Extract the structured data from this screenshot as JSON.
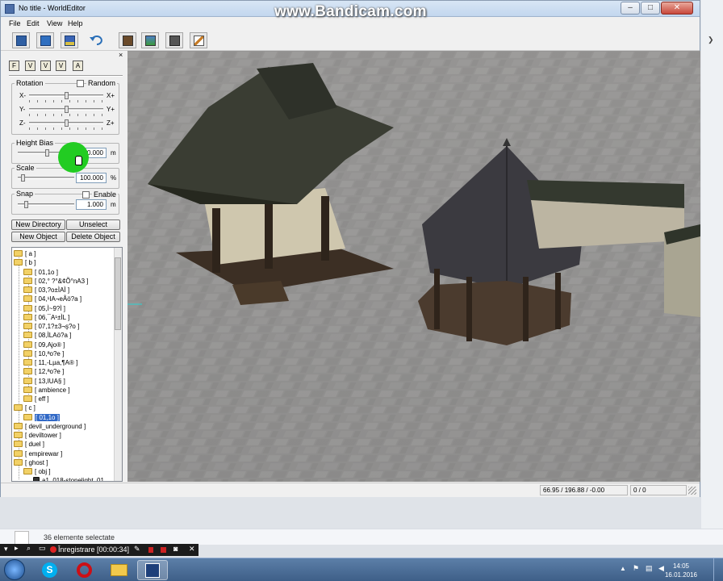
{
  "window": {
    "title": "No title - WorldEditor",
    "controls": {
      "minimize": "–",
      "maximize": "□",
      "close": "✕"
    }
  },
  "menu": [
    "File",
    "Edit",
    "View",
    "Help"
  ],
  "toolbar_icons": [
    "new-file-icon",
    "open-folder-icon",
    "save-icon",
    "undo-icon",
    "object-view-icon",
    "terrain-view-icon",
    "attribute-view-icon",
    "edit-pencil-icon"
  ],
  "panel": {
    "close": "×",
    "mode_buttons": [
      "F",
      "V",
      "V",
      "V",
      "A"
    ],
    "rotation": {
      "label": "Rotation",
      "random_label": "Random",
      "x_minus": "X-",
      "x_plus": "X+",
      "y_minus": "Y-",
      "y_plus": "Y+",
      "z_minus": "Z-",
      "z_plus": "Z+"
    },
    "height_bias": {
      "label": "Height Bias",
      "value": "0.000",
      "unit": "m"
    },
    "scale": {
      "label": "Scale",
      "value": "100.000",
      "unit": "%"
    },
    "snap": {
      "label": "Snap",
      "enable_label": "Enable",
      "value": "1.000",
      "unit": "m"
    },
    "buttons": {
      "new_directory": "New Directory",
      "unselect": "Unselect",
      "new_object": "New Object",
      "delete_object": "Delete Object"
    }
  },
  "tree": [
    {
      "label": "[ a ]",
      "level": 0
    },
    {
      "label": "[ b ]",
      "level": 0
    },
    {
      "label": "[ 01,1o ]",
      "level": 1
    },
    {
      "label": "[ 02,° ?°&¢Õ°nA3 ]",
      "level": 1
    },
    {
      "label": "[ 03,?o±ÌAÌ ]",
      "level": 1
    },
    {
      "label": "[ 04,¹IA¬eÅö?a ]",
      "level": 1
    },
    {
      "label": "[ 05,Ì~9?Ì ]",
      "level": 1
    },
    {
      "label": "[ 06,¯A¹±ÌL ]",
      "level": 1
    },
    {
      "label": "[ 07,1?±3¬ş?o ]",
      "level": 1
    },
    {
      "label": "[ 08,ÌLAö?a ]",
      "level": 1
    },
    {
      "label": "[ 09,Ajo® ]",
      "level": 1
    },
    {
      "label": "[ 10,ªo?e ]",
      "level": 1
    },
    {
      "label": "[ 11,-Lµa,¶A® ]",
      "level": 1
    },
    {
      "label": "[ 12,ªo?e ]",
      "level": 1
    },
    {
      "label": "[ 13,IUA§ ]",
      "level": 1
    },
    {
      "label": "[ ambience ]",
      "level": 1
    },
    {
      "label": "[ eff ]",
      "level": 1
    },
    {
      "label": "[ c ]",
      "level": 0
    },
    {
      "label": "[ 01,1o ]",
      "level": 1,
      "selected": true
    },
    {
      "label": "[ devil_underground ]",
      "level": 0
    },
    {
      "label": "[ deviltower ]",
      "level": 0
    },
    {
      "label": "[ duel ]",
      "level": 0
    },
    {
      "label": "[ empirewar ]",
      "level": 0
    },
    {
      "label": "[ ghost ]",
      "level": 0
    },
    {
      "label": "[ obj ]",
      "level": 1
    },
    {
      "label": "a1_018-stonelight_01",
      "level": 2
    }
  ],
  "status": {
    "coords": "66.95 / 196.88 / -0.00",
    "count": "0 / 0"
  },
  "overlay": {
    "bandicam": "www.Bandicam.com"
  },
  "explorer": {
    "selection": "36 elemente selectate"
  },
  "recorder": {
    "label": "Înregistrare [00:00:34]"
  },
  "taskbar": {
    "apps": [
      "windows-start-icon",
      "skype-icon",
      "opera-icon",
      "folder-icon",
      "world-editor-icon"
    ],
    "time": "14:05",
    "date": "16.01.2016"
  },
  "colors": {
    "highlight": "#3169c6",
    "cursor_marker": "#22cc22",
    "taskbar": "#4a6a94"
  }
}
